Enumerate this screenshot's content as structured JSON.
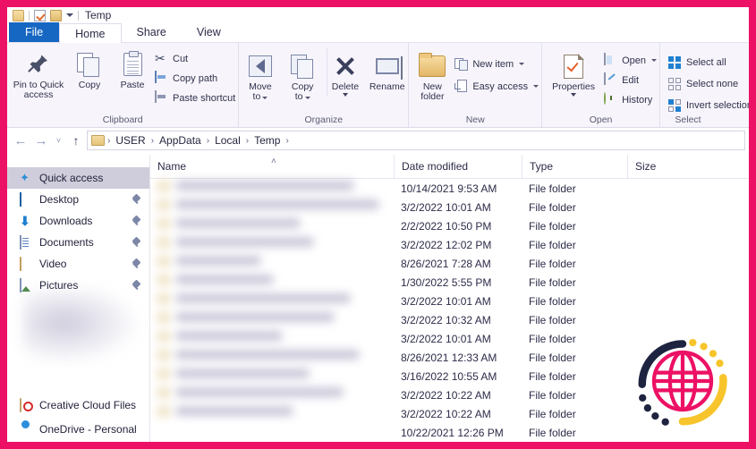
{
  "window": {
    "title": "Temp",
    "quick_access_icons": [
      "folder-icon",
      "properties-icon",
      "new-folder-icon",
      "customize-caret-icon"
    ]
  },
  "tabs": [
    {
      "label": "File",
      "name": "tab-file",
      "state": "file"
    },
    {
      "label": "Home",
      "name": "tab-home",
      "state": "active"
    },
    {
      "label": "Share",
      "name": "tab-share",
      "state": "normal"
    },
    {
      "label": "View",
      "name": "tab-view",
      "state": "normal"
    }
  ],
  "ribbon": {
    "clipboard": {
      "group_label": "Clipboard",
      "pin_to_quick_access": "Pin to Quick\naccess",
      "pin_line1": "Pin to Quick",
      "pin_line2": "access",
      "copy": "Copy",
      "paste": "Paste",
      "cut": "Cut",
      "copy_path": "Copy path",
      "paste_shortcut": "Paste shortcut"
    },
    "organize": {
      "group_label": "Organize",
      "move_to_line1": "Move",
      "move_to_line2": "to",
      "copy_to_line1": "Copy",
      "copy_to_line2": "to",
      "delete": "Delete",
      "rename": "Rename"
    },
    "new": {
      "group_label": "New",
      "new_folder_line1": "New",
      "new_folder_line2": "folder",
      "new_item": "New item",
      "easy_access": "Easy access"
    },
    "open": {
      "group_label": "Open",
      "properties": "Properties",
      "open": "Open",
      "edit": "Edit",
      "history": "History"
    },
    "select": {
      "group_label": "Select",
      "select_all": "Select all",
      "select_none": "Select none",
      "invert_selection": "Invert selection"
    }
  },
  "address": {
    "back": "←",
    "forward": "→",
    "recent": "˅",
    "up": "↑",
    "crumbs": [
      "USER",
      "AppData",
      "Local",
      "Temp"
    ],
    "separator": "›"
  },
  "sidebar": {
    "items": [
      {
        "label": "Quick access",
        "icon": "star-icon",
        "pinned": false,
        "selected": true
      },
      {
        "label": "Desktop",
        "icon": "desktop-icon",
        "pinned": true,
        "selected": false
      },
      {
        "label": "Downloads",
        "icon": "download-icon",
        "pinned": true,
        "selected": false
      },
      {
        "label": "Documents",
        "icon": "document-icon",
        "pinned": true,
        "selected": false
      },
      {
        "label": "Video",
        "icon": "folder-icon",
        "pinned": true,
        "selected": false
      },
      {
        "label": "Pictures",
        "icon": "picture-icon",
        "pinned": true,
        "selected": false
      },
      {
        "label": "Creative Cloud Files",
        "icon": "creative-cloud-icon",
        "pinned": false,
        "selected": false
      },
      {
        "label": "OneDrive - Personal",
        "icon": "onedrive-icon",
        "pinned": false,
        "selected": false
      }
    ]
  },
  "filelist": {
    "columns": [
      "Name",
      "Date modified",
      "Type",
      "Size"
    ],
    "sort_indicator": "˄",
    "rows": [
      {
        "name": "",
        "date": "10/14/2021 9:53 AM",
        "type": "File folder",
        "size": ""
      },
      {
        "name": "",
        "date": "3/2/2022 10:01 AM",
        "type": "File folder",
        "size": ""
      },
      {
        "name": "",
        "date": "2/2/2022 10:50 PM",
        "type": "File folder",
        "size": ""
      },
      {
        "name": "",
        "date": "3/2/2022 12:02 PM",
        "type": "File folder",
        "size": ""
      },
      {
        "name": "",
        "date": "8/26/2021 7:28 AM",
        "type": "File folder",
        "size": ""
      },
      {
        "name": "",
        "date": "1/30/2022 5:55 PM",
        "type": "File folder",
        "size": ""
      },
      {
        "name": "",
        "date": "3/2/2022 10:01 AM",
        "type": "File folder",
        "size": ""
      },
      {
        "name": "",
        "date": "3/2/2022 10:32 AM",
        "type": "File folder",
        "size": ""
      },
      {
        "name": "",
        "date": "3/2/2022 10:01 AM",
        "type": "File folder",
        "size": ""
      },
      {
        "name": "",
        "date": "8/26/2021 12:33 AM",
        "type": "File folder",
        "size": ""
      },
      {
        "name": "",
        "date": "3/16/2022 10:55 AM",
        "type": "File folder",
        "size": ""
      },
      {
        "name": "",
        "date": "3/2/2022 10:22 AM",
        "type": "File folder",
        "size": ""
      },
      {
        "name": "",
        "date": "3/2/2022 10:22 AM",
        "type": "File folder",
        "size": ""
      },
      {
        "name": "",
        "date": "10/22/2021 12:26 PM",
        "type": "File folder",
        "size": ""
      }
    ]
  },
  "colors": {
    "frame_pink": "#ec1164",
    "file_tab_blue": "#1667c2",
    "ribbon_bg": "#f7f5fb",
    "selection_gray": "#cfcddb",
    "logo_globe": "#ec1164",
    "logo_navy": "#1e2340",
    "logo_yellow": "#f7c52b"
  },
  "watermark": {
    "name": "globe-logo"
  }
}
